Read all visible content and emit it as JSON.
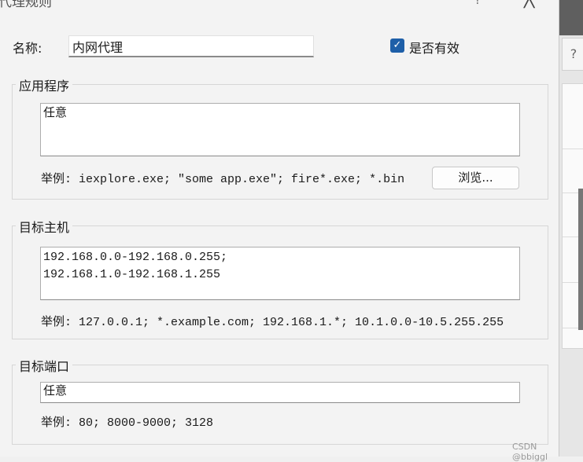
{
  "dialog": {
    "title": "代理规则",
    "help_glyph": "?",
    "close_glyph": "╳"
  },
  "name": {
    "label": "名称:",
    "value": "内网代理"
  },
  "enabled": {
    "label": "是否有效",
    "checked": true,
    "check_glyph": "✓"
  },
  "application": {
    "group_title": "应用程序",
    "value": "任意",
    "example": "举例: iexplore.exe; \"some app.exe\"; fire*.exe; *.bin",
    "browse_label": "浏览..."
  },
  "target_host": {
    "group_title": "目标主机",
    "value": "192.168.0.0-192.168.0.255;\n192.168.1.0-192.168.1.255",
    "example": "举例: 127.0.0.1; *.example.com; 192.168.1.*; 10.1.0.0-10.5.255.255"
  },
  "target_port": {
    "group_title": "目标端口",
    "value": "任意",
    "example": "举例: 80; 8000-9000; 3128"
  },
  "side_panel": {
    "help_glyph": "?"
  },
  "watermark": "CSDN @bbiggl"
}
